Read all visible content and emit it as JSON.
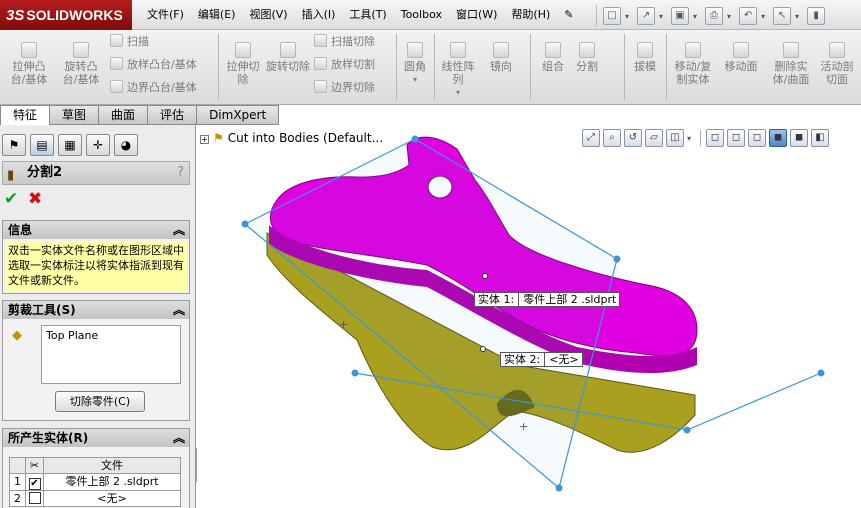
{
  "app": {
    "logo_mark": "3S",
    "logo_text": "SOLIDWORKS"
  },
  "menu": [
    "文件(F)",
    "编辑(E)",
    "视图(V)",
    "插入(I)",
    "工具(T)",
    "Toolbox",
    "窗口(W)",
    "帮助(H)"
  ],
  "ribbon": {
    "extrude_boss": "拉伸凸台/基体",
    "revolve_boss": "旋转凸台/基体",
    "sweep": "扫描",
    "loft": "放样凸台/基体",
    "boundary": "边界凸台/基体",
    "extrude_cut": "拉伸切除",
    "revolve_cut": "旋转切除",
    "sweep_cut": "扫描切除",
    "loft_cut": "放样切割",
    "boundary_cut": "边界切除",
    "fillet": "圆角",
    "linear_pattern": "线性阵列",
    "mirror": "镜向",
    "combine": "组合",
    "split": "分割",
    "draft": "拔模",
    "move_copy": "移动/复制实体",
    "move_face": "移动面",
    "delete_body": "删除实体/曲面",
    "live_section": "活动剖切面"
  },
  "tabs": [
    "特征",
    "草图",
    "曲面",
    "评估",
    "DimXpert"
  ],
  "property_manager": {
    "title": "分割2",
    "help": "?",
    "info_header": "信息",
    "info_text": "双击一实体文件名称或在图形区域中选取一实体标注以将实体指派到现有文件或新文件。",
    "trim_header": "剪裁工具(S)",
    "trim_items": [
      "Top Plane"
    ],
    "cut_button": "切除零件(C)",
    "bodies_header": "所产生实体(R)",
    "table_header_file": "文件",
    "rows": [
      {
        "num": "1",
        "checked": true,
        "file": "零件上部 2 .sldprt"
      },
      {
        "num": "2",
        "checked": false,
        "file": "<无>"
      }
    ]
  },
  "viewport": {
    "tree_node": "Cut into Bodies  (Default...",
    "callout1_label": "实体  1:",
    "callout1_value": "零件上部 2 .sldprt",
    "callout2_label": "实体  2:",
    "callout2_value": "<无>"
  },
  "colors": {
    "upper_body": "#e000e0",
    "lower_body": "#aaa020",
    "plane": "#3a96d8"
  },
  "icons": {
    "quickbar": [
      "new-icon",
      "open-icon",
      "save-icon",
      "print-icon",
      "undo-icon",
      "select-icon",
      "rebuild-icon"
    ],
    "view_toolbar": [
      "zoom-to-fit-icon",
      "zoom-area-icon",
      "previous-view-icon",
      "section-view-icon",
      "view-orientation-icon",
      "display-style-icon"
    ],
    "panel_tabs": [
      "feature-manager-icon",
      "property-manager-icon",
      "configuration-manager-icon",
      "dimxpert-manager-icon",
      "display-manager-icon"
    ]
  }
}
